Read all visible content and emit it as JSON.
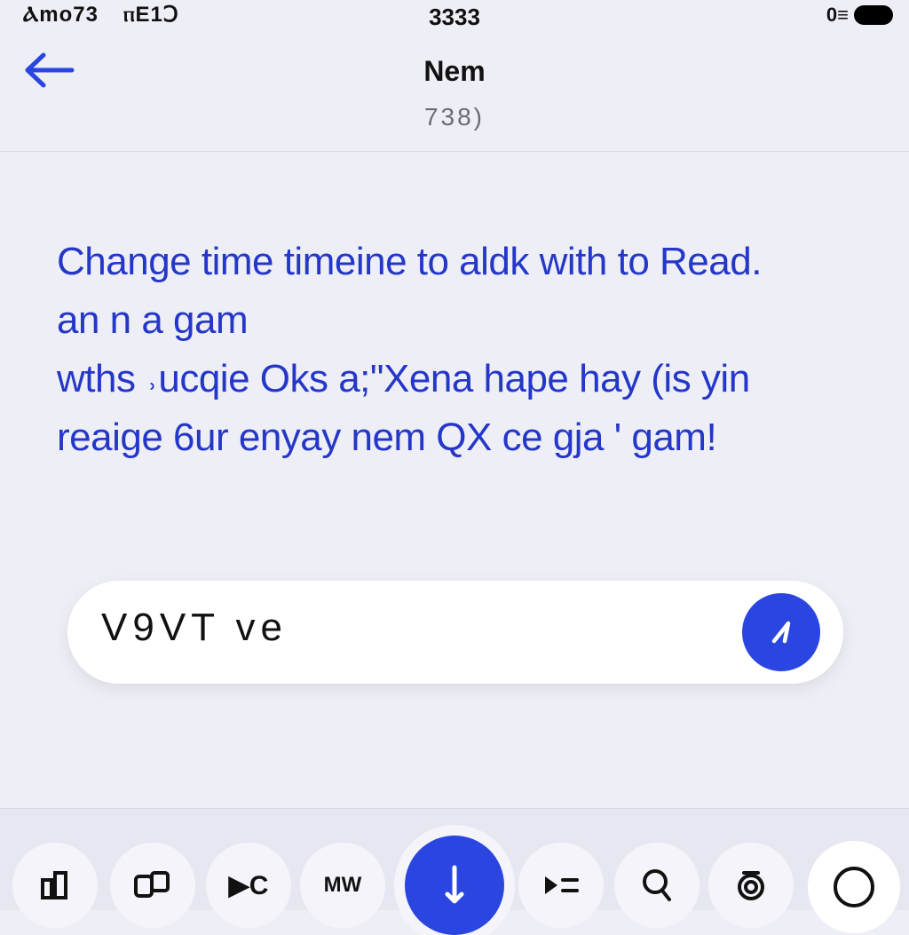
{
  "status_bar": {
    "left_text_1": "Ⲁmo73",
    "left_text_2": "ⲡE1Ↄ",
    "time": "3333",
    "network": "0≡"
  },
  "header": {
    "title": "Nem",
    "subtitle": "738)"
  },
  "message": {
    "lines": [
      "Change time timeine to aldk with to Read.",
      "an n a gam",
      "wths ˒ucqie Oks a;\"Xena hape hay (is yin",
      "reaige 6ur enyay nem QX ce gja ' gam!"
    ]
  },
  "input": {
    "value": "V9VT ve"
  },
  "toolbar": {
    "items": [
      {
        "icon": "tiles-icon",
        "label": ""
      },
      {
        "icon": "cards-icon",
        "label": ""
      },
      {
        "icon": "play-c-icon",
        "label": "▶C"
      },
      {
        "icon": "mw-icon",
        "label": "MW"
      },
      {
        "icon": "download-icon",
        "label": ""
      },
      {
        "icon": "list-play-icon",
        "label": ""
      },
      {
        "icon": "search-icon",
        "label": ""
      },
      {
        "icon": "gear-icon",
        "label": ""
      },
      {
        "icon": "circle-icon",
        "label": ""
      }
    ]
  },
  "colors": {
    "accent": "#2a45e0",
    "message_text": "#2437c8",
    "background": "#eeeef6"
  }
}
